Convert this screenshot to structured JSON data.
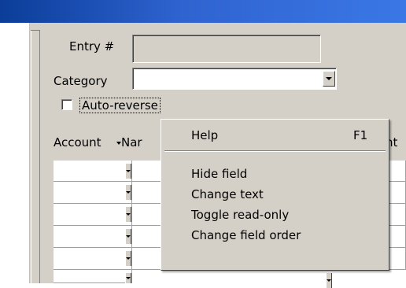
{
  "form": {
    "entry_label": "Entry #",
    "entry_value": "",
    "category_label": "Category",
    "category_value": "",
    "auto_reverse_label": "Auto-reverse",
    "auto_reverse_checked": false
  },
  "grid": {
    "columns": [
      "Account",
      "Nar",
      "nt"
    ],
    "row_count": 5
  },
  "context_menu": {
    "items": [
      {
        "label": "Help",
        "shortcut": "F1"
      },
      {
        "label": "Hide field"
      },
      {
        "label": "Change text"
      },
      {
        "label": "Toggle read-only"
      },
      {
        "label": "Change field order"
      }
    ]
  },
  "colors": {
    "titlebar": "#2f63d0",
    "face": "#d4d0c8"
  }
}
